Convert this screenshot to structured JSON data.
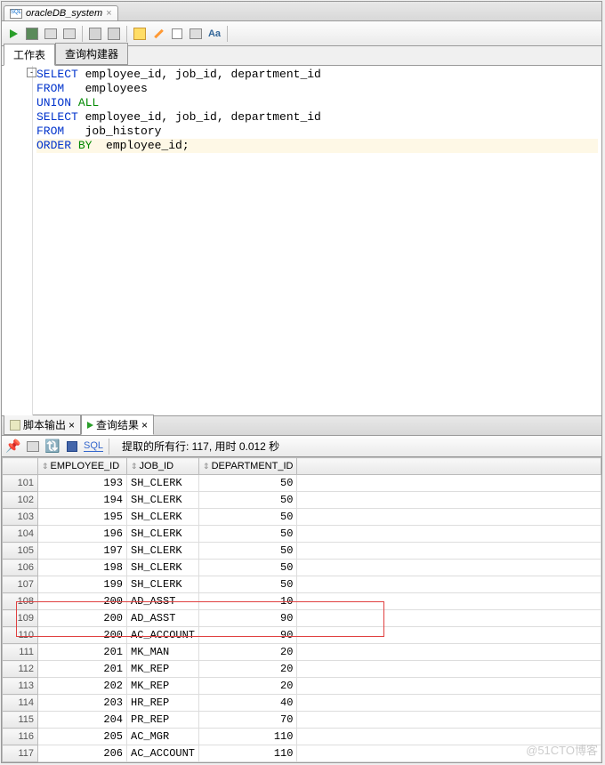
{
  "tab": {
    "title": "oracleDB_system",
    "close": "×"
  },
  "worksheet_tabs": {
    "worksheet": "工作表",
    "builder": "查询构建器"
  },
  "sql": {
    "line1_kw": "SELECT",
    "line1_rest": " employee_id, job_id, department_id",
    "line2_kw": "FROM",
    "line2_rest": "   employees",
    "line3_kw1": "UNION",
    "line3_kw2": " ALL",
    "line4_kw": "SELECT",
    "line4_rest": " employee_id, job_id, department_id",
    "line5_kw": "FROM",
    "line5_rest": "   job_history",
    "line6_kw1": "ORDER",
    "line6_kw2": " BY",
    "line6_rest": "  employee_id;"
  },
  "fold": "-",
  "result_tabs": {
    "script_out": "脚本输出",
    "query_result": "查询结果",
    "close": "×"
  },
  "result_toolbar": {
    "sql_link": "SQL",
    "status": "提取的所有行: 117, 用时 0.012 秒"
  },
  "columns": {
    "c0": "",
    "c1": "EMPLOYEE_ID",
    "c2": "JOB_ID",
    "c3": "DEPARTMENT_ID"
  },
  "rows": [
    {
      "n": "101",
      "emp": "193",
      "job": "SH_CLERK",
      "dept": "50"
    },
    {
      "n": "102",
      "emp": "194",
      "job": "SH_CLERK",
      "dept": "50"
    },
    {
      "n": "103",
      "emp": "195",
      "job": "SH_CLERK",
      "dept": "50"
    },
    {
      "n": "104",
      "emp": "196",
      "job": "SH_CLERK",
      "dept": "50"
    },
    {
      "n": "105",
      "emp": "197",
      "job": "SH_CLERK",
      "dept": "50"
    },
    {
      "n": "106",
      "emp": "198",
      "job": "SH_CLERK",
      "dept": "50"
    },
    {
      "n": "107",
      "emp": "199",
      "job": "SH_CLERK",
      "dept": "50"
    },
    {
      "n": "108",
      "emp": "200",
      "job": "AD_ASST",
      "dept": "10"
    },
    {
      "n": "109",
      "emp": "200",
      "job": "AD_ASST",
      "dept": "90"
    },
    {
      "n": "110",
      "emp": "200",
      "job": "AC_ACCOUNT",
      "dept": "90"
    },
    {
      "n": "111",
      "emp": "201",
      "job": "MK_MAN",
      "dept": "20"
    },
    {
      "n": "112",
      "emp": "201",
      "job": "MK_REP",
      "dept": "20"
    },
    {
      "n": "113",
      "emp": "202",
      "job": "MK_REP",
      "dept": "20"
    },
    {
      "n": "114",
      "emp": "203",
      "job": "HR_REP",
      "dept": "40"
    },
    {
      "n": "115",
      "emp": "204",
      "job": "PR_REP",
      "dept": "70"
    },
    {
      "n": "116",
      "emp": "205",
      "job": "AC_MGR",
      "dept": "110"
    },
    {
      "n": "117",
      "emp": "206",
      "job": "AC_ACCOUNT",
      "dept": "110"
    }
  ],
  "watermark": "@51CTO博客"
}
